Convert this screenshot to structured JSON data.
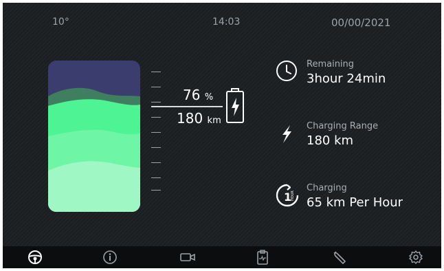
{
  "status": {
    "temperature": "10°",
    "time": "14:03",
    "date": "00/00/2021"
  },
  "battery": {
    "percent": "76",
    "percent_unit": "%",
    "range": "180",
    "range_unit": "km",
    "level": 0.76
  },
  "info": [
    {
      "label": "Remaining",
      "value_hours": "3",
      "hours_unit": "hour",
      "value_minutes": "24",
      "minutes_unit": "min",
      "icon": "clock-icon"
    },
    {
      "label": "Charging Range",
      "value": "180 km",
      "icon": "lightning-icon"
    },
    {
      "label": "Charging",
      "value": "65 km Per Hour",
      "icon": "one-hour-icon",
      "icon_text_big": "1",
      "icon_text_small": "HOUR"
    }
  ],
  "nav": [
    "steering-wheel-icon",
    "info-icon",
    "camera-icon",
    "clipboard-icon",
    "wrench-icon",
    "gear-icon"
  ],
  "colors": {
    "accent": "#4ef394",
    "background": "#1c1f22",
    "navbar": "#0c0d0f",
    "sky": "#3b3d6e"
  }
}
